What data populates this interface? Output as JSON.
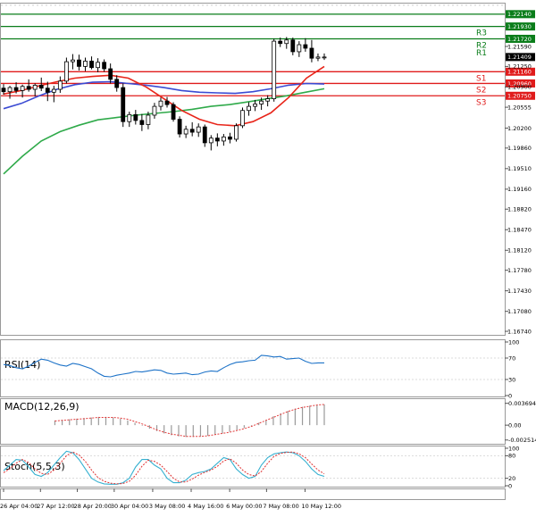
{
  "colors": {
    "background": "#ffffff",
    "resistance": "#0a7d1a",
    "support": "#e01b1b",
    "ma_fast": "#e8251a",
    "ma_mid": "#3b4bd3",
    "ma_slow": "#2faa4a",
    "candle_bull": "#ffffff",
    "candle_bear": "#000000",
    "rsi": "#1e73c8",
    "macd_signal": "#e33b3b",
    "macd_hist": "#9a9a9a",
    "stoch_k": "#35b0d0",
    "stoch_d": "#e03030"
  },
  "levels": [
    {
      "name": "",
      "price": 1.2214,
      "label": "1.22140",
      "kind": "resistance"
    },
    {
      "name": "R3",
      "price": 1.2193,
      "label": "1.21930",
      "kind": "resistance"
    },
    {
      "name": "R2",
      "price": 1.2172,
      "label": "1.21720",
      "kind": "resistance"
    },
    {
      "name": "R1",
      "price": 1.2159,
      "label": "1.21590",
      "kind": "resistance_tick"
    },
    {
      "name": "S1",
      "price": 1.2116,
      "label": "1.21160",
      "kind": "support"
    },
    {
      "name": "S2",
      "price": 1.2096,
      "label": "1.20960",
      "kind": "support"
    },
    {
      "name": "S3",
      "price": 1.2075,
      "label": "1.20750",
      "kind": "support"
    }
  ],
  "current_price": "1.21409",
  "chart_data": [
    {
      "type": "candlestick",
      "ylim": [
        1.1668,
        1.2232
      ],
      "y_ticks": [
        "1.21590",
        "1.21250",
        "1.20900",
        "1.20555",
        "1.20200",
        "1.19860",
        "1.19510",
        "1.19160",
        "1.18820",
        "1.18470",
        "1.18120",
        "1.17780",
        "1.17430",
        "1.17080",
        "1.16740"
      ],
      "time_labels": [
        "26 Apr 04:00",
        "27 Apr 12:00",
        "28 Apr 20:00",
        "30 Apr 04:00",
        "3 May 08:00",
        "4 May 16:00",
        "6 May 00:00",
        "7 May 08:00",
        "10 May 12:00"
      ],
      "candles": [
        {
          "o": 1.2088,
          "h": 1.2095,
          "l": 1.2077,
          "c": 1.2082
        },
        {
          "o": 1.2082,
          "h": 1.2092,
          "l": 1.207,
          "c": 1.2089
        },
        {
          "o": 1.2089,
          "h": 1.2098,
          "l": 1.2079,
          "c": 1.2084
        },
        {
          "o": 1.2084,
          "h": 1.2094,
          "l": 1.2072,
          "c": 1.2091
        },
        {
          "o": 1.2091,
          "h": 1.2103,
          "l": 1.2082,
          "c": 1.2086
        },
        {
          "o": 1.2086,
          "h": 1.2096,
          "l": 1.2074,
          "c": 1.2093
        },
        {
          "o": 1.2093,
          "h": 1.2106,
          "l": 1.2083,
          "c": 1.2088
        },
        {
          "o": 1.2088,
          "h": 1.2099,
          "l": 1.2066,
          "c": 1.2081
        },
        {
          "o": 1.2081,
          "h": 1.2092,
          "l": 1.2064,
          "c": 1.2086
        },
        {
          "o": 1.2086,
          "h": 1.2108,
          "l": 1.208,
          "c": 1.21
        },
        {
          "o": 1.21,
          "h": 1.214,
          "l": 1.2096,
          "c": 1.2133
        },
        {
          "o": 1.2133,
          "h": 1.2146,
          "l": 1.212,
          "c": 1.2136
        },
        {
          "o": 1.2136,
          "h": 1.2145,
          "l": 1.2118,
          "c": 1.2125
        },
        {
          "o": 1.2125,
          "h": 1.214,
          "l": 1.2117,
          "c": 1.2134
        },
        {
          "o": 1.2134,
          "h": 1.2142,
          "l": 1.212,
          "c": 1.2123
        },
        {
          "o": 1.2123,
          "h": 1.2139,
          "l": 1.2115,
          "c": 1.2132
        },
        {
          "o": 1.2132,
          "h": 1.2137,
          "l": 1.2116,
          "c": 1.2121
        },
        {
          "o": 1.2121,
          "h": 1.213,
          "l": 1.2096,
          "c": 1.2103
        },
        {
          "o": 1.2103,
          "h": 1.211,
          "l": 1.2082,
          "c": 1.2089
        },
        {
          "o": 1.2089,
          "h": 1.2096,
          "l": 1.2022,
          "c": 1.2031
        },
        {
          "o": 1.2031,
          "h": 1.2048,
          "l": 1.2022,
          "c": 1.2043
        },
        {
          "o": 1.2043,
          "h": 1.2051,
          "l": 1.2026,
          "c": 1.2033
        },
        {
          "o": 1.2033,
          "h": 1.2044,
          "l": 1.2015,
          "c": 1.2026
        },
        {
          "o": 1.2026,
          "h": 1.2048,
          "l": 1.2018,
          "c": 1.2042
        },
        {
          "o": 1.2042,
          "h": 1.2063,
          "l": 1.2036,
          "c": 1.2057
        },
        {
          "o": 1.2057,
          "h": 1.2072,
          "l": 1.205,
          "c": 1.2066
        },
        {
          "o": 1.2066,
          "h": 1.2073,
          "l": 1.2055,
          "c": 1.206
        },
        {
          "o": 1.206,
          "h": 1.2064,
          "l": 1.2031,
          "c": 1.2035
        },
        {
          "o": 1.2035,
          "h": 1.204,
          "l": 1.2004,
          "c": 1.201
        },
        {
          "o": 1.201,
          "h": 1.2024,
          "l": 1.2003,
          "c": 1.2018
        },
        {
          "o": 1.2018,
          "h": 1.203,
          "l": 1.2006,
          "c": 1.2013
        },
        {
          "o": 1.2013,
          "h": 1.2028,
          "l": 1.2005,
          "c": 1.2022
        },
        {
          "o": 1.2022,
          "h": 1.2026,
          "l": 1.1988,
          "c": 1.1995
        },
        {
          "o": 1.1995,
          "h": 1.2008,
          "l": 1.1982,
          "c": 1.2003
        },
        {
          "o": 1.2003,
          "h": 1.2011,
          "l": 1.1989,
          "c": 1.1998
        },
        {
          "o": 1.1998,
          "h": 1.201,
          "l": 1.199,
          "c": 1.2005
        },
        {
          "o": 1.2005,
          "h": 1.2012,
          "l": 1.1994,
          "c": 1.2001
        },
        {
          "o": 1.2001,
          "h": 1.2028,
          "l": 1.1997,
          "c": 1.2024
        },
        {
          "o": 1.2024,
          "h": 1.2055,
          "l": 1.202,
          "c": 1.205
        },
        {
          "o": 1.205,
          "h": 1.2064,
          "l": 1.2041,
          "c": 1.2057
        },
        {
          "o": 1.2057,
          "h": 1.2068,
          "l": 1.2049,
          "c": 1.2061
        },
        {
          "o": 1.2061,
          "h": 1.2072,
          "l": 1.2051,
          "c": 1.2066
        },
        {
          "o": 1.2066,
          "h": 1.2076,
          "l": 1.2057,
          "c": 1.207
        },
        {
          "o": 1.207,
          "h": 1.2172,
          "l": 1.2065,
          "c": 1.2168
        },
        {
          "o": 1.2168,
          "h": 1.2174,
          "l": 1.2158,
          "c": 1.2164
        },
        {
          "o": 1.2164,
          "h": 1.2175,
          "l": 1.2155,
          "c": 1.217
        },
        {
          "o": 1.217,
          "h": 1.2174,
          "l": 1.2144,
          "c": 1.215
        },
        {
          "o": 1.215,
          "h": 1.2168,
          "l": 1.2141,
          "c": 1.2162
        },
        {
          "o": 1.2162,
          "h": 1.2173,
          "l": 1.215,
          "c": 1.2156
        },
        {
          "o": 1.2156,
          "h": 1.217,
          "l": 1.2132,
          "c": 1.2139
        },
        {
          "o": 1.2139,
          "h": 1.2147,
          "l": 1.2134,
          "c": 1.2141
        },
        {
          "o": 1.2141,
          "h": 1.2147,
          "l": 1.2136,
          "c": 1.2141
        }
      ],
      "ma_fast": [
        1.2078,
        1.2084,
        1.2092,
        1.2099,
        1.2105,
        1.2108,
        1.211,
        1.2105,
        1.209,
        1.207,
        1.205,
        1.2035,
        1.2026,
        1.2024,
        1.2031,
        1.2046,
        1.2072,
        1.2105,
        1.2125
      ],
      "ma_mid": [
        1.2053,
        1.2062,
        1.2075,
        1.2086,
        1.2094,
        1.2098,
        1.2099,
        1.2096,
        1.2093,
        1.2089,
        1.2084,
        1.2081,
        1.208,
        1.2079,
        1.2082,
        1.2087,
        1.2093,
        1.2096,
        1.2095
      ],
      "ma_slow": [
        1.1942,
        1.1972,
        1.1998,
        1.2014,
        1.2025,
        1.2034,
        1.2038,
        1.2042,
        1.2045,
        1.2048,
        1.2052,
        1.2057,
        1.206,
        1.2065,
        1.207,
        1.2075,
        1.2081,
        1.2087
      ]
    },
    {
      "type": "line",
      "title": "RSI(14)",
      "ylim": [
        0,
        100
      ],
      "y_ticks": [
        "100",
        "70",
        "30",
        "0"
      ],
      "values": [
        58,
        56,
        52,
        50,
        55,
        62,
        68,
        66,
        61,
        57,
        55,
        60,
        58,
        54,
        50,
        42,
        36,
        35,
        38,
        40,
        42,
        45,
        44,
        46,
        48,
        47,
        42,
        40,
        41,
        42,
        39,
        40,
        44,
        46,
        45,
        52,
        58,
        62,
        63,
        65,
        66,
        75,
        74,
        72,
        73,
        68,
        69,
        70,
        64,
        60,
        61,
        61
      ]
    },
    {
      "type": "bar",
      "title": "MACD(12,26,9)",
      "ylim": [
        -0.003,
        0.0041
      ],
      "y_ticks": [
        "0.003694",
        "0.00",
        "-0.002514"
      ],
      "histogram": [
        0.0008,
        0.0009,
        0.001,
        0.0011,
        0.0012,
        0.0013,
        0.0014,
        0.0014,
        0.0013,
        0.0011,
        0.0008,
        0.0004,
        -0.0001,
        -0.0006,
        -0.001,
        -0.0014,
        -0.0017,
        -0.0019,
        -0.002,
        -0.002,
        -0.0019,
        -0.0018,
        -0.0016,
        -0.0014,
        -0.0011,
        -0.0008,
        -0.0005,
        -0.0001,
        0.0004,
        0.0009,
        0.0015,
        0.002,
        0.0024,
        0.0028,
        0.0031,
        0.0033,
        0.0034,
        0.0035
      ],
      "signal": [
        0.0007,
        0.0008,
        0.0009,
        0.001,
        0.0011,
        0.0012,
        0.0013,
        0.0013,
        0.0013,
        0.0012,
        0.001,
        0.0006,
        0.0002,
        -0.0003,
        -0.0008,
        -0.0012,
        -0.0015,
        -0.0017,
        -0.0019,
        -0.0019,
        -0.0019,
        -0.0018,
        -0.0016,
        -0.0014,
        -0.0012,
        -0.0009,
        -0.0006,
        -0.0002,
        0.0003,
        0.0008,
        0.0013,
        0.0018,
        0.0023,
        0.0027,
        0.003,
        0.0032,
        0.0034,
        0.0035
      ]
    },
    {
      "type": "line",
      "title": "Stoch(5,5,3)",
      "ylim": [
        0,
        100
      ],
      "y_ticks": [
        "100",
        "80",
        "20",
        "0"
      ],
      "k": [
        40,
        55,
        70,
        68,
        50,
        30,
        25,
        35,
        55,
        75,
        92,
        88,
        70,
        45,
        20,
        10,
        5,
        4,
        4,
        8,
        20,
        50,
        70,
        70,
        55,
        45,
        20,
        8,
        8,
        15,
        30,
        35,
        38,
        45,
        60,
        75,
        70,
        45,
        30,
        20,
        25,
        55,
        75,
        85,
        88,
        90,
        88,
        80,
        65,
        45,
        30,
        25
      ],
      "d": [
        35,
        45,
        60,
        70,
        62,
        45,
        33,
        30,
        42,
        60,
        80,
        90,
        82,
        65,
        42,
        22,
        12,
        7,
        5,
        6,
        12,
        28,
        52,
        68,
        65,
        55,
        38,
        20,
        10,
        10,
        18,
        28,
        36,
        42,
        52,
        66,
        72,
        60,
        42,
        30,
        26,
        38,
        60,
        78,
        86,
        89,
        90,
        85,
        75,
        58,
        42,
        32
      ]
    }
  ]
}
